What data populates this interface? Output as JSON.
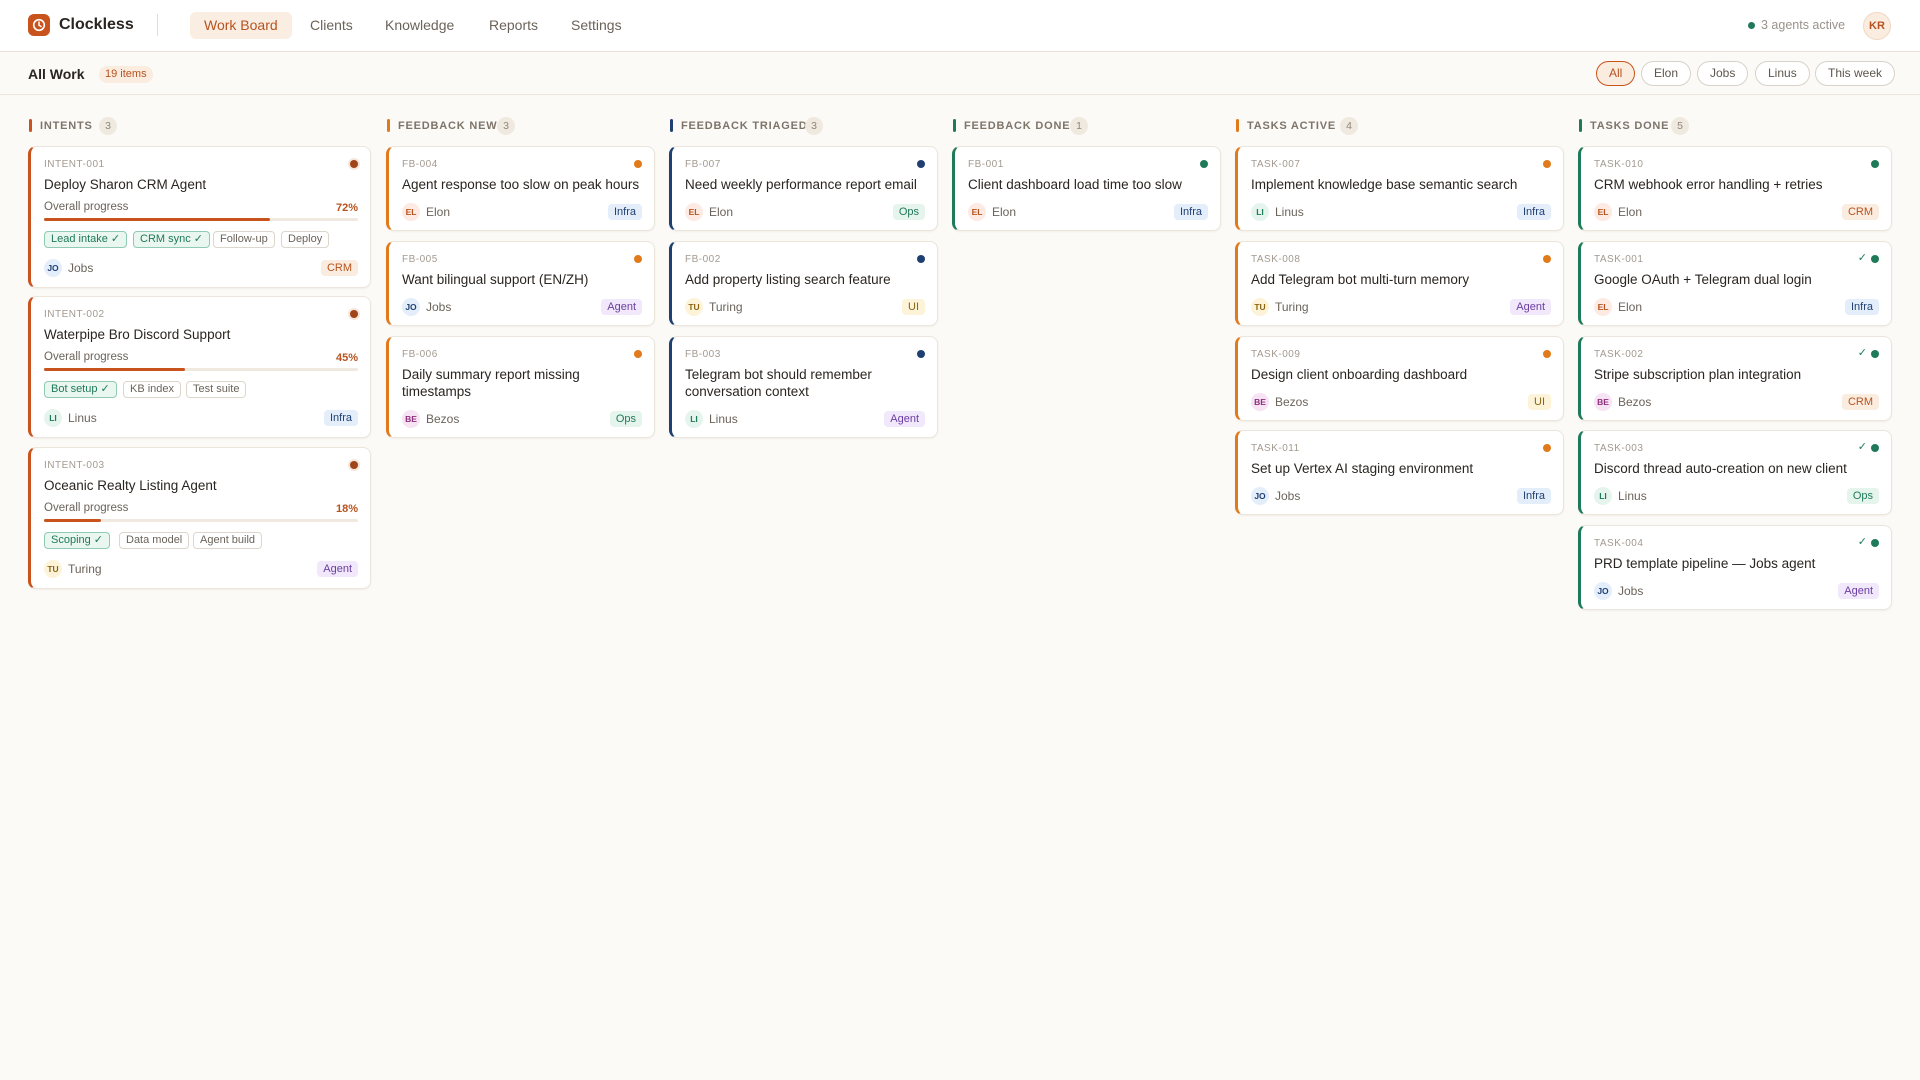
{
  "app": {
    "name": "Clockless",
    "logo_icon": "clock-icon"
  },
  "nav": [
    {
      "label": "Work Board",
      "active": true
    },
    {
      "label": "Clients",
      "active": false
    },
    {
      "label": "Knowledge",
      "active": false
    },
    {
      "label": "Reports",
      "active": false
    },
    {
      "label": "Settings",
      "active": false
    }
  ],
  "status": {
    "agents_text": "3 agents active",
    "user_initials": "KR"
  },
  "subheader": {
    "title": "All Work",
    "count": "19 items"
  },
  "filters": [
    {
      "label": "All",
      "active": true
    },
    {
      "label": "Elon",
      "active": false
    },
    {
      "label": "Jobs",
      "active": false
    },
    {
      "label": "Linus",
      "active": false
    },
    {
      "label": "This week",
      "active": false
    }
  ],
  "colors": {
    "accent": "#c9531c",
    "orange": "#e07a1a",
    "navy": "#1f3f73",
    "green": "#1f7a5a",
    "intent_bar": "#c9531c"
  },
  "columns": [
    {
      "label": "INTENTS",
      "count": "3"
    },
    {
      "label": "FEEDBACK NEW",
      "count": "3"
    },
    {
      "label": "FEEDBACK TRIAGED",
      "count": "3"
    },
    {
      "label": "FEEDBACK DONE",
      "count": "1"
    },
    {
      "label": "TASKS ACTIVE",
      "count": "4"
    },
    {
      "label": "TASKS DONE",
      "count": "5"
    }
  ],
  "intents": [
    {
      "id": "INTENT-001",
      "title": "Deploy Sharon CRM Agent",
      "progress_label": "Overall progress",
      "progress": "72%",
      "progress_value": 0.72,
      "steps": [
        {
          "label": "Lead intake ✓",
          "done": true
        },
        {
          "label": "CRM sync ✓",
          "done": true
        },
        {
          "label": "Follow-up",
          "done": false
        },
        {
          "label": "Deploy",
          "done": false
        }
      ],
      "assignee_initials": "JO",
      "assignee": "Jobs",
      "tag": "CRM"
    },
    {
      "id": "INTENT-002",
      "title": "Waterpipe Bro Discord Support",
      "progress_label": "Overall progress",
      "progress": "45%",
      "progress_value": 0.45,
      "steps": [
        {
          "label": "Bot setup ✓",
          "done": true
        },
        {
          "label": "KB index",
          "done": false
        },
        {
          "label": "Test suite",
          "done": false
        }
      ],
      "assignee_initials": "LI",
      "assignee": "Linus",
      "tag": "Infra"
    },
    {
      "id": "INTENT-003",
      "title": "Oceanic Realty Listing Agent",
      "progress_label": "Overall progress",
      "progress": "18%",
      "progress_value": 0.18,
      "steps": [
        {
          "label": "Scoping ✓",
          "done": true
        },
        {
          "label": "Data model",
          "done": false
        },
        {
          "label": "Agent build",
          "done": false
        }
      ],
      "assignee_initials": "TU",
      "assignee": "Turing",
      "tag": "Agent"
    }
  ],
  "feedback_new": [
    {
      "id": "FB-004",
      "title": "Agent response too slow on peak hours",
      "assignee_initials": "EL",
      "assignee": "Elon",
      "tag": "Infra"
    },
    {
      "id": "FB-005",
      "title": "Want bilingual support (EN/ZH)",
      "assignee_initials": "JO",
      "assignee": "Jobs",
      "tag": "Agent"
    },
    {
      "id": "FB-006",
      "title": "Daily summary report missing timestamps",
      "assignee_initials": "BE",
      "assignee": "Bezos",
      "tag": "Ops"
    }
  ],
  "feedback_triaged": [
    {
      "id": "FB-007",
      "title": "Need weekly performance report email",
      "assignee_initials": "EL",
      "assignee": "Elon",
      "tag": "Ops"
    },
    {
      "id": "FB-002",
      "title": "Add property listing search feature",
      "assignee_initials": "TU",
      "assignee": "Turing",
      "tag": "UI"
    },
    {
      "id": "FB-003",
      "title": "Telegram bot should remember conversation context",
      "assignee_initials": "LI",
      "assignee": "Linus",
      "tag": "Agent"
    }
  ],
  "feedback_done": [
    {
      "id": "FB-001",
      "title": "Client dashboard load time too slow",
      "assignee_initials": "EL",
      "assignee": "Elon",
      "tag": "Infra"
    }
  ],
  "tasks_active": [
    {
      "id": "TASK-007",
      "title": "Implement knowledge base semantic search",
      "assignee_initials": "LI",
      "assignee": "Linus",
      "tag": "Infra"
    },
    {
      "id": "TASK-008",
      "title": "Add Telegram bot multi-turn memory",
      "assignee_initials": "TU",
      "assignee": "Turing",
      "tag": "Agent"
    },
    {
      "id": "TASK-009",
      "title": "Design client onboarding dashboard",
      "assignee_initials": "BE",
      "assignee": "Bezos",
      "tag": "UI"
    },
    {
      "id": "TASK-011",
      "title": "Set up Vertex AI staging environment",
      "assignee_initials": "JO",
      "assignee": "Jobs",
      "tag": "Infra"
    }
  ],
  "tasks_done": [
    {
      "id": "TASK-010",
      "title": "CRM webhook error handling + retries",
      "assignee_initials": "EL",
      "assignee": "Elon",
      "tag": "CRM"
    },
    {
      "id": "TASK-001",
      "title": "Google OAuth + Telegram dual login",
      "assignee_initials": "EL",
      "assignee": "Elon",
      "tag": "Infra"
    },
    {
      "id": "TASK-002",
      "title": "Stripe subscription plan integration",
      "assignee_initials": "BE",
      "assignee": "Bezos",
      "tag": "CRM"
    },
    {
      "id": "TASK-003",
      "title": "Discord thread auto-creation on new client",
      "assignee_initials": "LI",
      "assignee": "Linus",
      "tag": "Ops"
    },
    {
      "id": "TASK-004",
      "title": "PRD template pipeline — Jobs agent",
      "assignee_initials": "JO",
      "assignee": "Jobs",
      "tag": "Agent"
    }
  ]
}
